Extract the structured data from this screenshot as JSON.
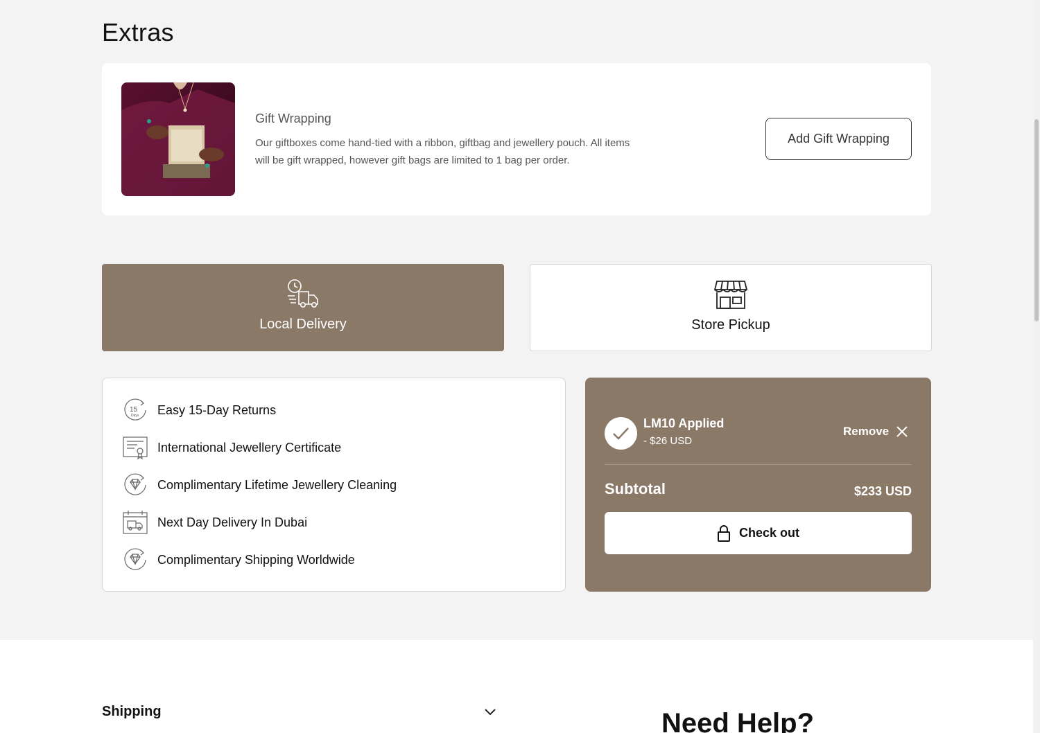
{
  "extras": {
    "title": "Extras"
  },
  "gift_wrapping": {
    "title": "Gift Wrapping",
    "description": "Our giftboxes come hand-tied with a ribbon, giftbag and jewellery pouch. All items will be gift wrapped, however gift bags are limited to 1 bag per order.",
    "button_label": "Add Gift Wrapping"
  },
  "delivery_options": {
    "local": {
      "label": "Local Delivery",
      "icon": "delivery-truck-clock-icon",
      "selected": true
    },
    "pickup": {
      "label": "Store Pickup",
      "icon": "storefront-icon",
      "selected": false
    }
  },
  "benefits": [
    {
      "label": "Easy 15-Day Returns",
      "icon": "15-day-returns-icon"
    },
    {
      "label": "International Jewellery Certificate",
      "icon": "certificate-icon"
    },
    {
      "label": "Complimentary Lifetime Jewellery Cleaning",
      "icon": "diamond-cycle-icon"
    },
    {
      "label": "Next Day Delivery In Dubai",
      "icon": "calendar-truck-icon"
    },
    {
      "label": "Complimentary Shipping Worldwide",
      "icon": "diamond-cycle-icon"
    }
  ],
  "summary": {
    "discount_code": "LM10 Applied",
    "discount_amount": "- $26 USD",
    "remove_label": "Remove",
    "subtotal_label": "Subtotal",
    "subtotal_value": "$233 USD",
    "checkout_label": "Check out"
  },
  "footer": {
    "shipping_label": "Shipping",
    "need_help": "Need Help?"
  },
  "colors": {
    "accent": "#8b7968",
    "background": "#f3f3f3",
    "card": "#ffffff"
  }
}
